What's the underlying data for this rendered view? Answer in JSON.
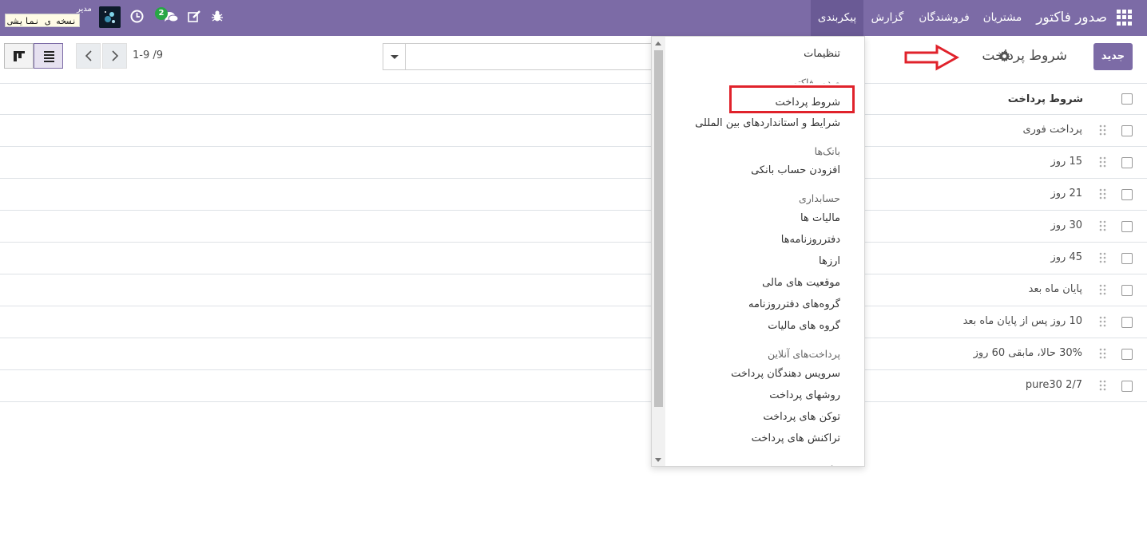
{
  "navbar": {
    "brand": "صدور فاکتور",
    "menus": [
      "مشتریان",
      "فروشندگان",
      "گزارش",
      "پیکربندی"
    ],
    "messages_badge": "2",
    "user_name": "مدیر",
    "demo_label": "نسخه ی نمایشی"
  },
  "control_panel": {
    "new_button": "جدید",
    "breadcrumb": "شروط پرداخت",
    "pager": "1-9 /9",
    "search_placeholder": ""
  },
  "list": {
    "column_title": "شروط پرداخت",
    "rows": [
      "پرداخت فوری",
      "15 روز",
      "21 روز",
      "30 روز",
      "45 روز",
      "پایان ماه بعد",
      "10 روز پس از پایان ماه بعد",
      "30% حالا، مابقی 60 روز",
      "2/7 pure30"
    ]
  },
  "dropdown": {
    "settings": "تنظیمات",
    "sections": [
      {
        "title": "صدور فاکتور",
        "items": [
          "شروط پرداخت",
          "شرایط و استانداردهای بین المللی"
        ]
      },
      {
        "title": "بانک‌ها",
        "items": [
          "افزودن حساب بانکی"
        ]
      },
      {
        "title": "حسابداری",
        "items": [
          "مالیات ها",
          "دفترروزنامه‌ها",
          "ارزها",
          "موقعیت های مالی",
          "گروه‌های دفترروزنامه",
          "گروه های مالیات"
        ]
      },
      {
        "title": "پرداخت‌های آنلاین",
        "items": [
          "سرویس دهندگان پرداخت",
          "روشهای پرداخت",
          "توکن های پرداخت",
          "تراکنش های پرداخت"
        ]
      },
      {
        "title": "مدیریت"
      }
    ]
  },
  "colors": {
    "brand": "#7c6ba6",
    "annotation_red": "#e0222b",
    "badge_green": "#28a745"
  }
}
